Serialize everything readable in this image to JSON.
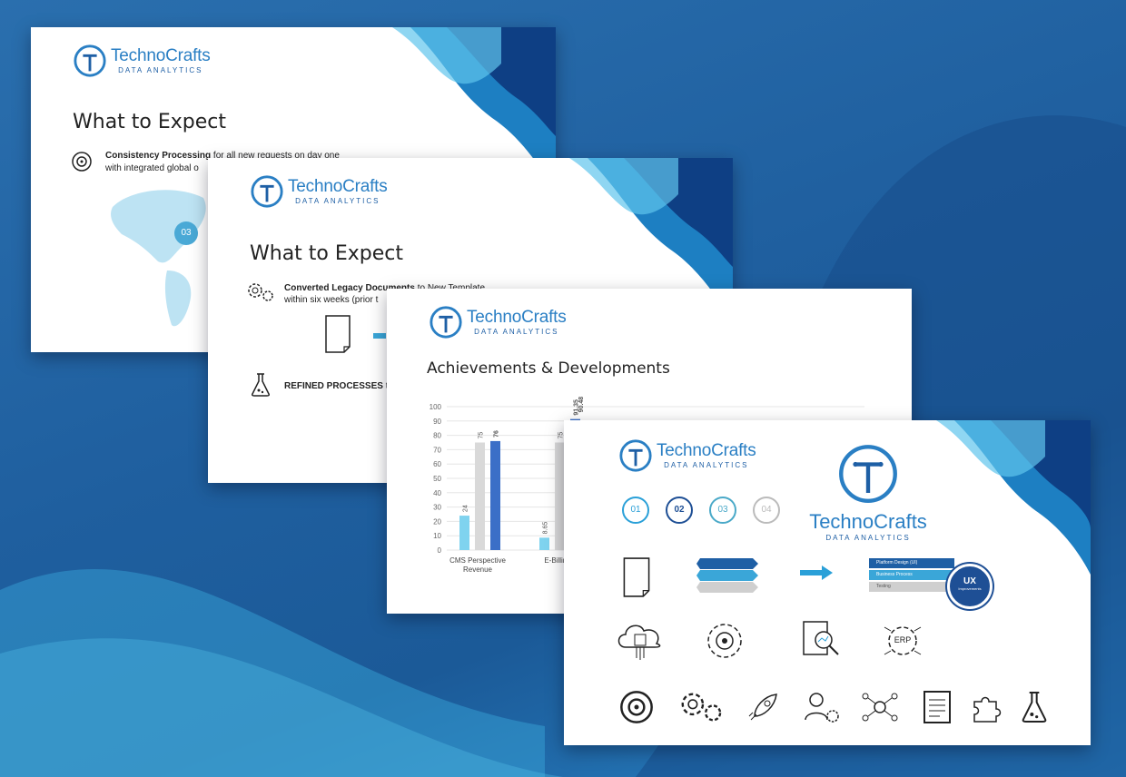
{
  "brand": {
    "name": "TechnoCrafts",
    "tagline": "DATA ANALYTICS"
  },
  "slide1": {
    "title": "What to Expect",
    "bold": "Consistency Processing",
    "rest": " for all new requests on day one",
    "line2": "with integrated global o",
    "pin": "03"
  },
  "slide2": {
    "title": "What to Expect",
    "bold": "Converted Legacy Documents",
    "rest": " to New Template",
    "line2": "within six weeks (prior t",
    "refined_bold": "REFINED PROCESSES",
    "refined_rest": " to"
  },
  "slide3": {
    "title": "Achievements & Developments"
  },
  "slide4": {
    "steps": [
      "01",
      "02",
      "03",
      "04"
    ],
    "layers": [
      "Platform Design (UI)",
      "Business Process",
      "Testing"
    ],
    "ux": "UX",
    "ux_sub": "Improvements",
    "erp": "ERP"
  },
  "chart_data": {
    "type": "bar",
    "categories": [
      "CMS Perspective Revenue",
      "E-Billing"
    ],
    "category_lines": [
      [
        "CMS Perspective",
        "Revenue"
      ],
      [
        "E-Billing"
      ]
    ],
    "series": [
      {
        "values": [
          24,
          8.65
        ]
      },
      {
        "values": [
          75,
          75
        ]
      },
      {
        "values": [
          76,
          91.35
        ]
      }
    ],
    "extra_label": "90.48",
    "ylim": [
      0,
      100
    ],
    "yticks": [
      0,
      10,
      20,
      30,
      40,
      50,
      60,
      70,
      80,
      90,
      100
    ],
    "colors": [
      "#7fd3ef",
      "#d9d9d9",
      "#3b6fc7"
    ]
  }
}
